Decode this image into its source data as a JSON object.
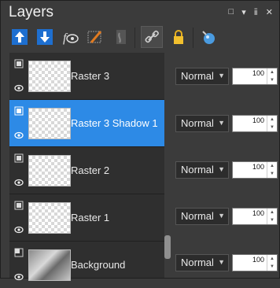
{
  "panel": {
    "title": "Layers",
    "window_buttons": [
      "□",
      "▾",
      "ⅱ",
      "✕"
    ]
  },
  "toolbar": {
    "icons": [
      "new-raster-layer-icon",
      "new-vector-layer-icon",
      "visibility-icon",
      "edit-icon",
      "mask-icon",
      "link-icon",
      "lock-icon",
      "adjustment-icon"
    ]
  },
  "layers": [
    {
      "name": "Raster 3",
      "blend": "Normal",
      "opacity": "100",
      "selected": false
    },
    {
      "name": "Raster 3 Shadow 1",
      "blend": "Normal",
      "opacity": "100",
      "selected": true
    },
    {
      "name": "Raster 2",
      "blend": "Normal",
      "opacity": "100",
      "selected": false
    },
    {
      "name": "Raster 1",
      "blend": "Normal",
      "opacity": "100",
      "selected": false
    },
    {
      "name": "Background",
      "blend": "Normal",
      "opacity": "100",
      "selected": false
    }
  ],
  "colors": {
    "selection": "#2d8ae6",
    "background": "#3b3b3b"
  }
}
